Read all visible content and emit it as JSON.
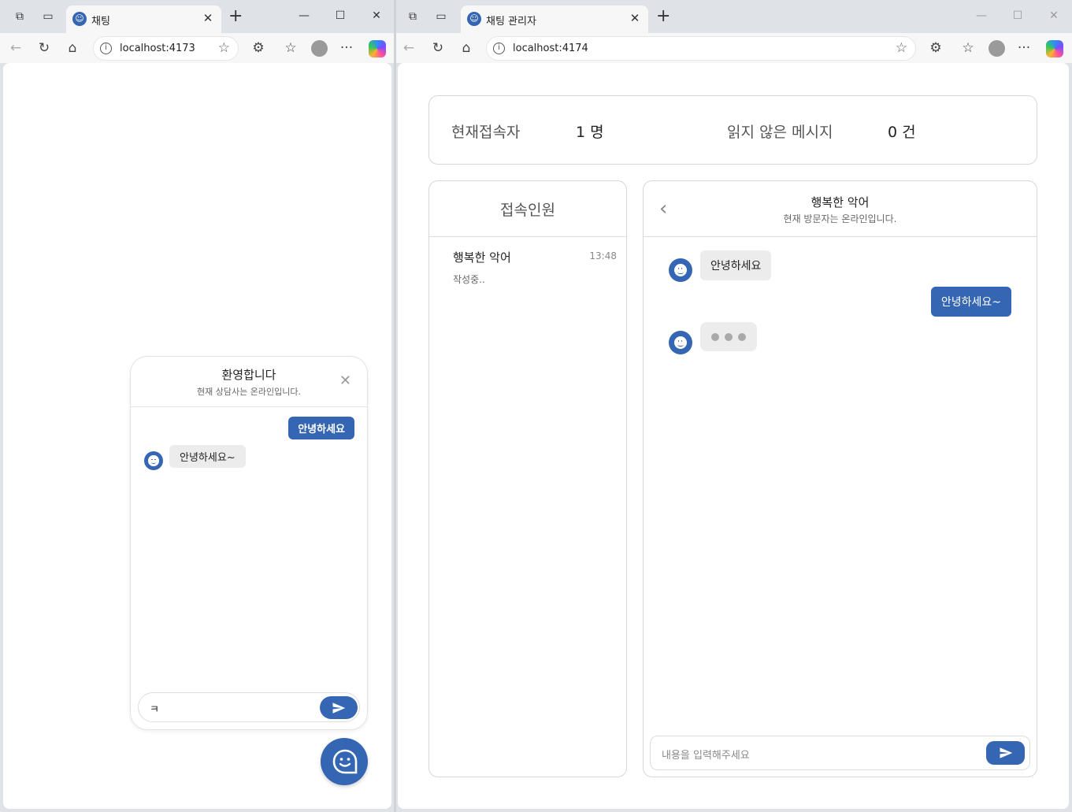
{
  "left_window": {
    "tab": {
      "title": "채팅"
    },
    "address": {
      "url": "localhost:4173"
    },
    "widget": {
      "title": "환영합니다",
      "subtitle": "현재 상담사는 온라인입니다.",
      "messages": [
        {
          "sender": "me",
          "text": "안녕하세요"
        },
        {
          "sender": "bot",
          "text": "안녕하세요~"
        }
      ],
      "input_value": "ㅋ"
    }
  },
  "right_window": {
    "tab": {
      "title": "채팅 관리자"
    },
    "address": {
      "url": "localhost:4174"
    },
    "stats": {
      "connected_label": "현재접속자",
      "connected_value": "1 명",
      "unread_label": "읽지 않은 메시지",
      "unread_value": "0 건"
    },
    "users_panel": {
      "title": "접속인원",
      "users": [
        {
          "name": "행복한 악어",
          "time": "13:48",
          "status": "작성중.."
        }
      ]
    },
    "chat_panel": {
      "title": "행복한 악어",
      "subtitle": "현재 방문자는 온라인입니다.",
      "messages": [
        {
          "sender": "visitor",
          "text": "안녕하세요"
        },
        {
          "sender": "me",
          "text": "안녕하세요~"
        }
      ],
      "input_placeholder": "내용을 입력해주세요"
    }
  },
  "colors": {
    "accent": "#3566b3",
    "bubble_gray": "#ececec"
  },
  "icons": [
    "workspaces-icon",
    "tab-actions-icon",
    "close-icon",
    "new-tab-icon",
    "minimize-icon",
    "maximize-icon",
    "back-icon",
    "refresh-icon",
    "home-icon",
    "info-icon",
    "favorite-star-icon",
    "extensions-icon",
    "favorites-icon",
    "profile-icon",
    "more-icon",
    "copilot-icon",
    "send-icon",
    "chat-bot-icon",
    "chevron-left-icon"
  ]
}
